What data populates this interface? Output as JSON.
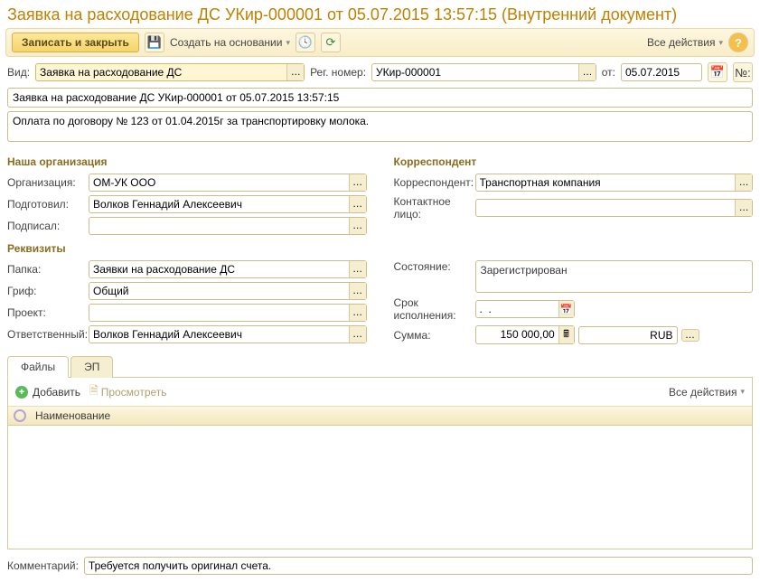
{
  "title": "Заявка на расходование ДС УКир-000001 от 05.07.2015 13:57:15 (Внутренний документ)",
  "toolbar": {
    "save_close": "Записать и закрыть",
    "create_based": "Создать на основании",
    "all_actions": "Все действия"
  },
  "top": {
    "vid_label": "Вид:",
    "vid_value": "Заявка на расходование ДС",
    "reg_label": "Рег. номер:",
    "reg_value": "УКир-000001",
    "ot_label": "от:",
    "date_value": "05.07.2015",
    "num_label": "№:"
  },
  "name_line": "Заявка на расходование ДС УКир-000001 от 05.07.2015 13:57:15",
  "desc": "Оплата по договору № 123 от 01.04.2015г за транспортировку молока.",
  "org_section": {
    "title": "Наша организация",
    "org_label": "Организация:",
    "org_value": "ОМ-УК ООО",
    "prep_label": "Подготовил:",
    "prep_value": "Волков Геннадий Алексеевич",
    "sign_label": "Подписал:",
    "sign_value": ""
  },
  "corr_section": {
    "title": "Корреспондент",
    "corr_label": "Корреспондент:",
    "corr_value": "Транспортная компания",
    "contact_label": "Контактное лицо:",
    "contact_value": ""
  },
  "req_section": {
    "title": "Реквизиты",
    "folder_label": "Папка:",
    "folder_value": "Заявки на расходование ДС",
    "grif_label": "Гриф:",
    "grif_value": "Общий",
    "project_label": "Проект:",
    "project_value": "",
    "resp_label": "Ответственный:",
    "resp_value": "Волков Геннадий Алексеевич",
    "state_label": "Состояние:",
    "state_value": "Зарегистрирован",
    "deadline_label": "Срок исполнения:",
    "deadline_value": ".  .",
    "sum_label": "Сумма:",
    "sum_value": "150 000,00",
    "currency": "RUB"
  },
  "tabs": {
    "files": "Файлы",
    "ep": "ЭП",
    "add": "Добавить",
    "view": "Просмотреть",
    "all_actions": "Все действия",
    "col_name": "Наименование"
  },
  "bottom": {
    "comment_label": "Комментарий:",
    "comment_value": "Требуется получить оригинал счета."
  }
}
